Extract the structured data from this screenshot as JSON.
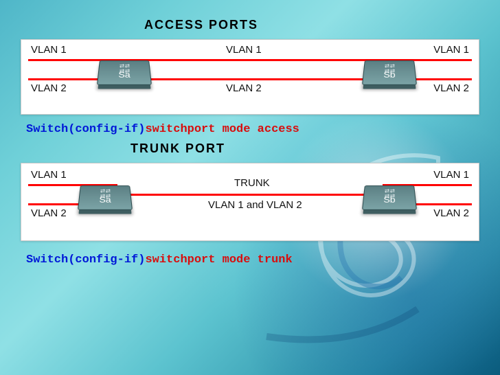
{
  "titles": {
    "access": "ACCESS PORTS",
    "trunk": "TRUNK PORT"
  },
  "access": {
    "labels": {
      "v1a": "VLAN 1",
      "v1b": "VLAN 1",
      "v1c": "VLAN 1",
      "v2a": "VLAN 2",
      "v2b": "VLAN 2",
      "v2c": "VLAN 2"
    },
    "switches": {
      "sa": "Sa",
      "sb": "Sb"
    },
    "cmd": {
      "prompt": "Switch(config-if)",
      "body": "switchport mode access"
    }
  },
  "trunk": {
    "labels": {
      "v1a": "VLAN 1",
      "v1c": "VLAN 1",
      "v2a": "VLAN 2",
      "v2c": "VLAN 2",
      "mid_top": "TRUNK",
      "mid_bot": "VLAN 1 and VLAN 2"
    },
    "switches": {
      "sa": "Sa",
      "sb": "Sb"
    },
    "cmd": {
      "prompt": "Switch(config-if)",
      "body": "switchport mode trunk"
    }
  }
}
